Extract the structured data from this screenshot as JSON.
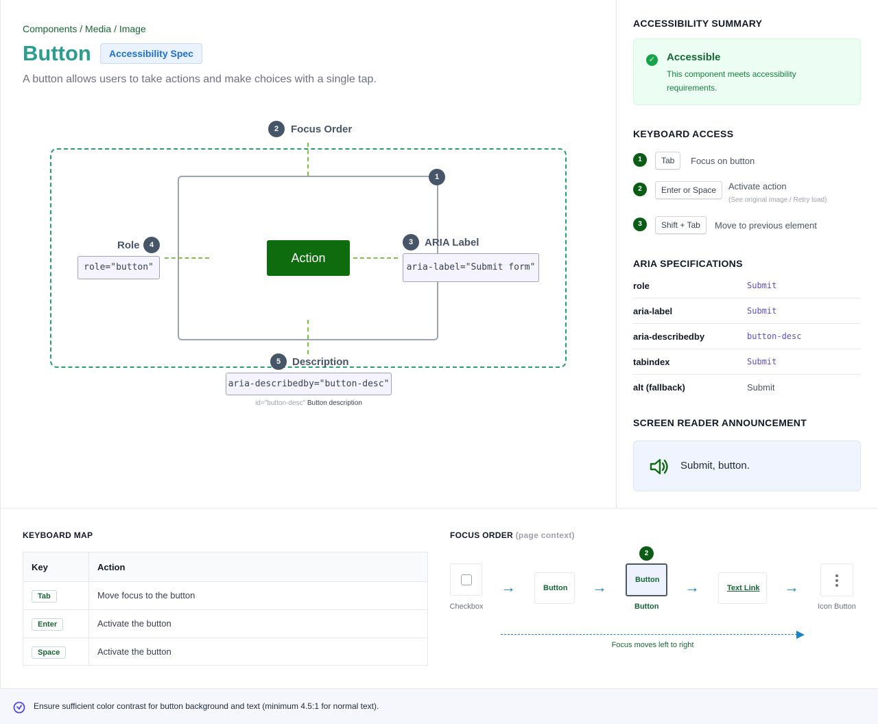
{
  "breadcrumb": "Components / Media / Image",
  "title": "Button",
  "spec_badge": "Accessibility Spec",
  "description": "A button allows users to take actions and make choices with a single tap.",
  "diagram": {
    "focus_order": {
      "num": "2",
      "label": "Focus Order"
    },
    "component": {
      "num": "1"
    },
    "role": {
      "num": "4",
      "label": "Role",
      "code": "role=\"button\""
    },
    "aria_label": {
      "num": "3",
      "label": "ARIA Label",
      "code": "aria-label=\"Submit form\""
    },
    "description": {
      "num": "5",
      "label": "Description",
      "code": "aria-describedby=\"button-desc\"",
      "note_id": "id=\"button-desc\"",
      "note_text": "Button description"
    },
    "action_button": "Action"
  },
  "summary": {
    "title": "ACCESSIBILITY SUMMARY",
    "status": "Accessible",
    "text": "This component meets accessibility requirements."
  },
  "keyboard_access": {
    "title": "KEYBOARD ACCESS",
    "items": [
      {
        "num": "1",
        "key": "Tab",
        "text": "Focus on button",
        "sub": ""
      },
      {
        "num": "2",
        "key": "Enter or Space",
        "text": "Activate action",
        "sub": "(See original image / Retry load)"
      },
      {
        "num": "3",
        "key": "Shift + Tab",
        "text": "Move to previous element",
        "sub": ""
      }
    ]
  },
  "aria_specs": {
    "title": "ARIA SPECIFICATIONS",
    "rows": [
      {
        "key": "role",
        "value": "Submit"
      },
      {
        "key": "aria-label",
        "value": "Submit"
      },
      {
        "key": "aria-describedby",
        "value": "button-desc"
      },
      {
        "key": "tabindex",
        "value": "Submit"
      },
      {
        "key": "alt (fallback)",
        "value": "Submit"
      }
    ]
  },
  "screen_reader": {
    "title": "SCREEN READER ANNOUNCEMENT",
    "text": "Submit, button."
  },
  "keyboard_map": {
    "title": "KEYBOARD MAP",
    "headers": {
      "key": "Key",
      "action": "Action"
    },
    "rows": [
      {
        "key": "Tab",
        "action": "Move focus to the button"
      },
      {
        "key": "Enter",
        "action": "Activate the button"
      },
      {
        "key": "Space",
        "action": "Activate the button"
      }
    ]
  },
  "focus_order": {
    "title": "FOCUS ORDER",
    "context": "(page context)",
    "items": {
      "checkbox_caption": "Checkbox",
      "button1": "Button",
      "button2": "Button",
      "button2_caption": "Button",
      "button2_num": "2",
      "text_link": "Text Link",
      "icon_caption": "Icon Button"
    },
    "arrow": "→",
    "flow_caption": "Focus moves left to right"
  },
  "note": "Ensure sufficient color contrast for button background and text (minimum 4.5:1 for normal text).",
  "colors": {
    "primary_green": "#0e6b0e",
    "title_teal": "#2a9d8f",
    "dash_green": "#25a06a",
    "slate": "#475569",
    "link_blue": "#1683c9"
  }
}
